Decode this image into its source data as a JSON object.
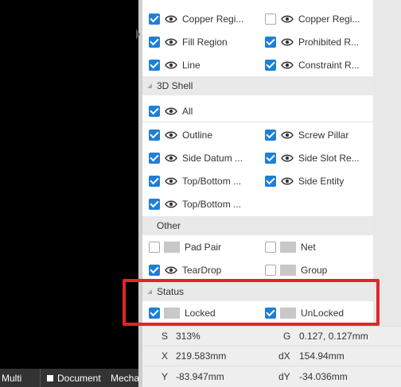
{
  "layer_bar": {
    "items": [
      {
        "label": "Multi",
        "color": ""
      },
      {
        "label": "Document",
        "color": "#ffffff"
      },
      {
        "label": "Mecha",
        "color": "#d62ad6"
      }
    ]
  },
  "sections": {
    "three_d_shell": "3D Shell",
    "other": "Other",
    "status": "Status"
  },
  "rows": {
    "r0": {
      "c1": {
        "label": "Copper Regi...",
        "checked": true,
        "icon": "eye-icon"
      },
      "c2": {
        "label": "Copper Regi...",
        "checked": false,
        "icon": "eye-icon"
      }
    },
    "r1": {
      "c1": {
        "label": "Fill Region",
        "checked": true,
        "icon": "eye-icon"
      },
      "c2": {
        "label": "Prohibited R...",
        "checked": true,
        "icon": "eye-icon"
      }
    },
    "r2": {
      "c1": {
        "label": "Line",
        "checked": true,
        "icon": "eye-icon"
      },
      "c2": {
        "label": "Constraint R...",
        "checked": true,
        "icon": "eye-icon"
      }
    },
    "r3": {
      "c1": {
        "label": "All",
        "checked": true,
        "icon": "eye-icon"
      }
    },
    "r4": {
      "c1": {
        "label": "Outline",
        "checked": true,
        "icon": "eye-icon"
      },
      "c2": {
        "label": "Screw Pillar",
        "checked": true,
        "icon": "eye-icon"
      }
    },
    "r5": {
      "c1": {
        "label": "Side Datum ...",
        "checked": true,
        "icon": "eye-icon"
      },
      "c2": {
        "label": "Side Slot Re...",
        "checked": true,
        "icon": "eye-icon"
      }
    },
    "r6": {
      "c1": {
        "label": "Top/Bottom ...",
        "checked": true,
        "icon": "eye-icon"
      },
      "c2": {
        "label": "Side Entity",
        "checked": true,
        "icon": "eye-icon"
      }
    },
    "r7": {
      "c1": {
        "label": "Top/Bottom ...",
        "checked": true,
        "icon": "eye-icon"
      }
    },
    "r8": {
      "c1": {
        "label": "Pad Pair",
        "checked": false,
        "icon": "swatch"
      },
      "c2": {
        "label": "Net",
        "checked": false,
        "icon": "swatch"
      }
    },
    "r9": {
      "c1": {
        "label": "TearDrop",
        "checked": true,
        "icon": "eye-icon"
      },
      "c2": {
        "label": "Group",
        "checked": false,
        "icon": "swatch"
      }
    },
    "r10": {
      "c1": {
        "label": "Locked",
        "checked": true,
        "icon": "swatch"
      },
      "c2": {
        "label": "UnLocked",
        "checked": true,
        "icon": "swatch"
      }
    }
  },
  "readout": {
    "s_label": "S",
    "s_value": "313%",
    "g_label": "G",
    "g_value": "0.127, 0.127mm",
    "x_label": "X",
    "x_value": "219.583mm",
    "dx_label": "dX",
    "dx_value": "154.94mm",
    "y_label": "Y",
    "y_value": "-83.947mm",
    "dy_label": "dY",
    "dy_value": "-34.036mm"
  },
  "colors": {
    "checkbox_on": "#1e7fd6",
    "highlight": "#e0252b",
    "section_bg": "#e9e9e9"
  }
}
